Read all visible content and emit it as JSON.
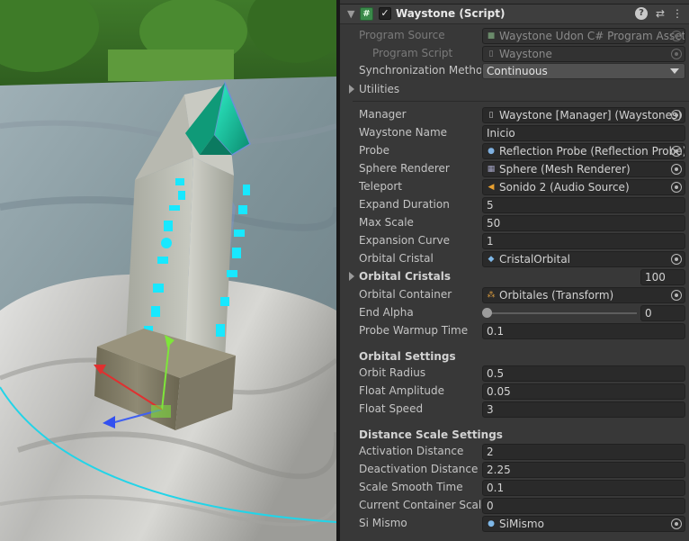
{
  "header": {
    "title": "Waystone (Script)",
    "script_icon": "#",
    "enabled_mark": "✓",
    "help_icon": "?",
    "settings_icon": "⇄",
    "menu_icon": "⋮"
  },
  "fields": {
    "program_source": {
      "label": "Program Source",
      "value": "Waystone Udon C# Program Asset"
    },
    "program_script": {
      "label": "Program Script",
      "value": "Waystone"
    },
    "sync_method": {
      "label": "Synchronization Method",
      "value": "Continuous"
    },
    "utilities": {
      "label": "Utilities"
    },
    "manager": {
      "label": "Manager",
      "value": "Waystone [Manager] (Waystones)"
    },
    "waystone_name": {
      "label": "Waystone Name",
      "value": "Inicio"
    },
    "probe": {
      "label": "Probe",
      "value": "Reflection Probe (Reflection Probe)"
    },
    "sphere_renderer": {
      "label": "Sphere Renderer",
      "value": "Sphere (Mesh Renderer)"
    },
    "teleport": {
      "label": "Teleport",
      "value": "Sonido 2 (Audio Source)"
    },
    "expand_duration": {
      "label": "Expand Duration",
      "value": "5"
    },
    "max_scale": {
      "label": "Max Scale",
      "value": "50"
    },
    "expansion_curve": {
      "label": "Expansion Curve",
      "value": "1"
    },
    "orbital_cristal": {
      "label": "Orbital Cristal",
      "value": "CristalOrbital"
    },
    "orbital_cristals": {
      "label": "Orbital Cristals",
      "count": "100"
    },
    "orbital_container": {
      "label": "Orbital Container",
      "value": "Orbitales (Transform)"
    },
    "end_alpha": {
      "label": "End Alpha",
      "value": "0",
      "level": 0
    },
    "probe_warmup_time": {
      "label": "Probe Warmup Time",
      "value": "0.1"
    }
  },
  "orbital_settings": {
    "title": "Orbital Settings",
    "orbit_radius": {
      "label": "Orbit Radius",
      "value": "0.5"
    },
    "float_amplitude": {
      "label": "Float Amplitude",
      "value": "0.05"
    },
    "float_speed": {
      "label": "Float Speed",
      "value": "3"
    }
  },
  "distance_scale_settings": {
    "title": "Distance Scale Settings",
    "activation_distance": {
      "label": "Activation Distance",
      "value": "2"
    },
    "deactivation_distance": {
      "label": "Deactivation Distance",
      "value": "2.25"
    },
    "scale_smooth_time": {
      "label": "Scale Smooth Time",
      "value": "0.1"
    },
    "current_container_scale": {
      "label": "Current Container Scale",
      "value": "0"
    },
    "si_mismo": {
      "label": "Si Mismo",
      "value": "SiMismo"
    }
  },
  "colors": {
    "panel_bg": "#383838",
    "field_bg": "#2a2a2a",
    "crystal_glow": "#18e8ff",
    "selection_outline": "#6f8fd6"
  }
}
